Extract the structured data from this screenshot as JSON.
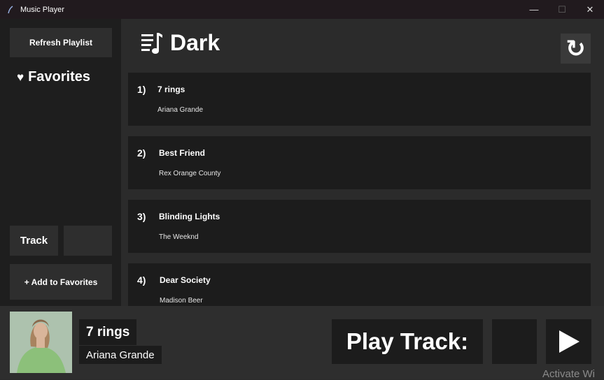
{
  "window": {
    "title": "Music Player",
    "controls": {
      "minimize": "—",
      "maximize": "☐",
      "close": "✕"
    }
  },
  "sidebar": {
    "refresh_label": "Refresh Playlist",
    "favorites_icon": "♥",
    "favorites_title": "Favorites",
    "track_label": "Track",
    "track_input_value": "",
    "add_favorites_label": "+ Add to Favorites"
  },
  "playlist": {
    "icon": "playlist-icon",
    "title": "Dark",
    "reload_icon": "↻",
    "tracks": [
      {
        "number": "1)",
        "name": "7 rings",
        "artist": "Ariana Grande"
      },
      {
        "number": "2)",
        "name": "Best Friend",
        "artist": "Rex Orange County"
      },
      {
        "number": "3)",
        "name": "Blinding Lights",
        "artist": "The Weeknd"
      },
      {
        "number": "4)",
        "name": "Dear Society",
        "artist": "Madison Beer"
      }
    ]
  },
  "now_playing": {
    "title": "7 rings",
    "artist": "Ariana Grande",
    "play_track_label": "Play Track:",
    "play_input_value": "",
    "play_icon": "play-icon"
  },
  "watermark": "Activate Wi"
}
